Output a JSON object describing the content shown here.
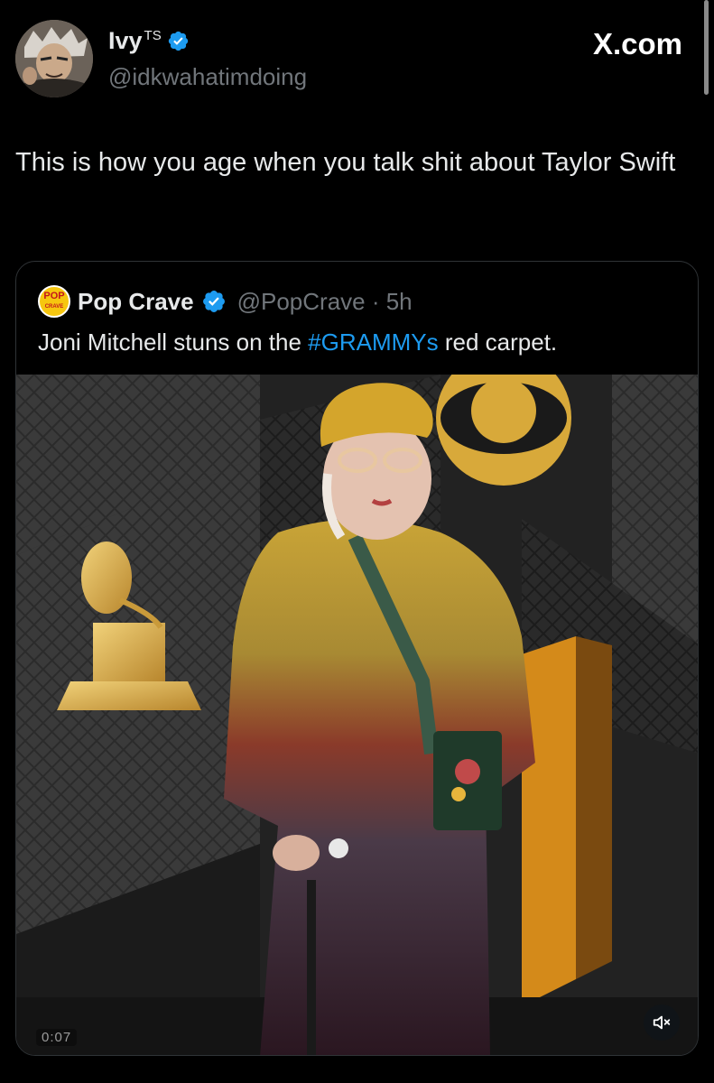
{
  "author": {
    "display_name": "Ivy",
    "superscript": "TS",
    "handle": "@idkwahatimdoing",
    "verified": true
  },
  "site_badge": "X.com",
  "tweet": {
    "text": "This is how you age when you talk shit about Taylor Swift"
  },
  "quoted_tweet": {
    "logo_text_top": "POP",
    "logo_text_bottom": "CRAVE",
    "display_name": "Pop Crave",
    "verified": true,
    "handle_time": "@PopCrave · 5h",
    "text_before": "Joni Mitchell stuns on the ",
    "hashtag": "#GRAMMYs",
    "text_after": " red carpet.",
    "video": {
      "timestamp": "0:07",
      "mute_icon": "speaker-muted-icon"
    }
  },
  "colors": {
    "background": "#000000",
    "text": "#e7e9ea",
    "muted": "#71767b",
    "link": "#1d9bf0",
    "verified": "#1d9bf0",
    "card_border": "#2f3336"
  }
}
